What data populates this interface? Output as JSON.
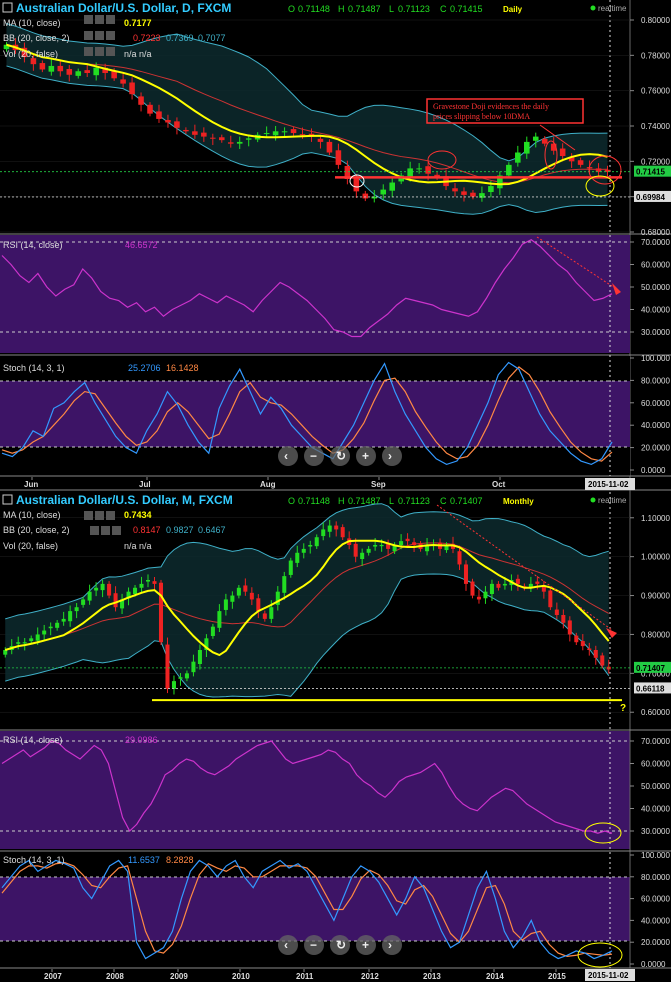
{
  "colors": {
    "up": "#22dd22",
    "down": "#ee2222",
    "ma": "#ffff00",
    "bb": "#3fb0c8",
    "bb_mid": "#cc3333",
    "rsi": "#cc33cc",
    "stoch_k": "#3399ff",
    "stoch_d": "#ff8844",
    "panel_purple": "#3d1466",
    "accent_cyan": "#33ccff",
    "hline": "#ff3333",
    "support": "#ffff00"
  },
  "daily": {
    "title": "Australian Dollar/U.S. Dollar, D, FXCM",
    "ohlc": {
      "o_label": "O",
      "o": "0.71148",
      "h_label": "H",
      "h": "0.71487",
      "l_label": "L",
      "l": "0.71123",
      "c_label": "C",
      "c": "0.71415"
    },
    "period_label": "Daily",
    "realtime": "realtime",
    "ma_label": "MA (10, close)",
    "ma_val": "0.7177",
    "bb_label": "BB (20, close, 2)",
    "bb_vals": [
      "0.7223",
      "0.7369",
      "0.7077"
    ],
    "vol_label": "Vol (20, false)",
    "vol_vals": "n/a  n/a",
    "annotation": [
      "Gravestone Doji evidences the daily",
      "prices slipping below 10DMA"
    ],
    "price_axis": [
      "0.80000",
      "0.78000",
      "0.76000",
      "0.74000",
      "0.72000",
      "0.70000",
      "0.68000"
    ],
    "price_tags": [
      "0.71415",
      "0.69984"
    ],
    "rsi_label": "RSI (14, close)",
    "rsi_val": "46.6572",
    "rsi_axis": [
      "70.0000",
      "60.0000",
      "50.0000",
      "40.0000",
      "30.0000"
    ],
    "stoch_label": "Stoch (14, 3, 1)",
    "stoch_k": "25.2706",
    "stoch_d": "16.1428",
    "stoch_axis": [
      "100.000",
      "80.0000",
      "60.0000",
      "40.0000",
      "20.0000",
      "0.0000"
    ],
    "months": [
      "Jun",
      "Jul",
      "Aug",
      "Sep",
      "Oct"
    ],
    "date_tag": "2015-11-02"
  },
  "monthly": {
    "title": "Australian Dollar/U.S. Dollar, M, FXCM",
    "ohlc": {
      "o_label": "O",
      "o": "0.71148",
      "h_label": "H",
      "h": "0.71487",
      "l_label": "L",
      "l": "0.71123",
      "c_label": "C",
      "c": "0.71407"
    },
    "period_label": "Monthly",
    "realtime": "realtime",
    "ma_label": "MA (10, close)",
    "ma_val": "0.7434",
    "bb_label": "BB (20, close, 2)",
    "bb_vals": [
      "0.8147",
      "0.9827",
      "0.6467"
    ],
    "vol_label": "Vol (20, false)",
    "vol_vals": "n/a  n/a",
    "price_axis": [
      "1.10000",
      "1.00000",
      "0.90000",
      "0.80000",
      "0.70000",
      "0.60000"
    ],
    "price_tags": [
      "0.71407",
      "0.66118"
    ],
    "question": "?",
    "rsi_label": "RSI (14, close)",
    "rsi_val": "29.0986",
    "rsi_axis": [
      "70.0000",
      "60.0000",
      "50.0000",
      "40.0000",
      "30.0000"
    ],
    "stoch_label": "Stoch (14, 3, 1)",
    "stoch_k": "11.6537",
    "stoch_d": "8.2828",
    "stoch_axis": [
      "100.000",
      "80.0000",
      "60.0000",
      "40.0000",
      "20.0000",
      "0.0000"
    ],
    "years": [
      "2007",
      "2008",
      "2009",
      "2010",
      "2011",
      "2012",
      "2013",
      "2014",
      "2015"
    ],
    "date_tag": "2015-11-02"
  },
  "nav_icons": [
    "chevron-left-icon",
    "minus-icon",
    "reset-icon",
    "plus-icon",
    "chevron-right-icon"
  ],
  "chart_data": [
    {
      "type": "candlestick",
      "title": "Australian Dollar/U.S. Dollar, D, FXCM",
      "ylim": [
        0.68,
        0.8
      ],
      "x_labels": [
        "Jun",
        "Jul",
        "Aug",
        "Sep",
        "Oct"
      ],
      "close_path": [
        0.786,
        0.783,
        0.779,
        0.775,
        0.772,
        0.774,
        0.771,
        0.769,
        0.771,
        0.77,
        0.773,
        0.77,
        0.767,
        0.764,
        0.758,
        0.752,
        0.747,
        0.744,
        0.742,
        0.739,
        0.737,
        0.735,
        0.734,
        0.733,
        0.732,
        0.73,
        0.731,
        0.733,
        0.735,
        0.736,
        0.737,
        0.737,
        0.736,
        0.735,
        0.734,
        0.731,
        0.725,
        0.718,
        0.71,
        0.703,
        0.699,
        0.7,
        0.704,
        0.708,
        0.712,
        0.716,
        0.716,
        0.713,
        0.711,
        0.706,
        0.703,
        0.701,
        0.7,
        0.702,
        0.706,
        0.712,
        0.718,
        0.725,
        0.731,
        0.734,
        0.73,
        0.726,
        0.723,
        0.72,
        0.718,
        0.716,
        0.714,
        0.714
      ],
      "ma10_last": 0.7177,
      "bb": {
        "mid": 0.7223,
        "upper": 0.7369,
        "lower": 0.7077
      },
      "last": {
        "open": 0.71148,
        "high": 0.71487,
        "low": 0.71123,
        "close": 0.71415
      },
      "support_line": 0.7109,
      "rsi": [
        64,
        60,
        55,
        52,
        56,
        50,
        46,
        49,
        51,
        58,
        54,
        48,
        45,
        44,
        41,
        43,
        39,
        41,
        37,
        40,
        42,
        44,
        47,
        45,
        43,
        46,
        44,
        42,
        39,
        44,
        48,
        52,
        50,
        47,
        44,
        40,
        36,
        31,
        30,
        28,
        28,
        32,
        35,
        38,
        42,
        45,
        44,
        43,
        42,
        40,
        39,
        38,
        37,
        39,
        45,
        52,
        58,
        63,
        69,
        71,
        68,
        64,
        60,
        57,
        52,
        48,
        44,
        45,
        47
      ],
      "stoch_k": [
        15,
        12,
        20,
        35,
        30,
        55,
        60,
        70,
        78,
        60,
        45,
        30,
        20,
        15,
        35,
        50,
        70,
        58,
        40,
        25,
        15,
        55,
        75,
        90,
        70,
        50,
        65,
        55,
        40,
        30,
        20,
        15,
        10,
        25,
        40,
        60,
        80,
        95,
        70,
        50,
        35,
        20,
        10,
        5,
        8,
        20,
        40,
        60,
        85,
        96,
        90,
        70,
        50,
        35,
        25,
        15,
        8,
        5,
        10,
        25
      ],
      "stoch_d": [
        18,
        15,
        18,
        25,
        30,
        40,
        50,
        62,
        70,
        68,
        55,
        42,
        30,
        22,
        25,
        35,
        52,
        60,
        52,
        40,
        28,
        32,
        50,
        70,
        78,
        65,
        60,
        58,
        50,
        40,
        30,
        22,
        15,
        18,
        28,
        42,
        62,
        80,
        82,
        70,
        52,
        38,
        25,
        15,
        10,
        12,
        22,
        40,
        62,
        82,
        92,
        85,
        70,
        52,
        38,
        25,
        16,
        10,
        8,
        16
      ]
    },
    {
      "type": "candlestick",
      "title": "Australian Dollar/U.S. Dollar, M, FXCM",
      "ylim": [
        0.58,
        1.12
      ],
      "x_labels": [
        "2007",
        "2008",
        "2009",
        "2010",
        "2011",
        "2012",
        "2013",
        "2014",
        "2015"
      ],
      "close_path": [
        0.76,
        0.77,
        0.78,
        0.78,
        0.79,
        0.8,
        0.81,
        0.82,
        0.83,
        0.84,
        0.86,
        0.87,
        0.89,
        0.91,
        0.92,
        0.93,
        0.9,
        0.87,
        0.89,
        0.91,
        0.92,
        0.93,
        0.94,
        0.93,
        0.78,
        0.66,
        0.68,
        0.69,
        0.7,
        0.73,
        0.76,
        0.79,
        0.82,
        0.86,
        0.89,
        0.9,
        0.92,
        0.91,
        0.89,
        0.86,
        0.84,
        0.87,
        0.91,
        0.95,
        0.99,
        1.01,
        1.02,
        1.03,
        1.05,
        1.07,
        1.08,
        1.07,
        1.05,
        1.03,
        1.0,
        1.01,
        1.02,
        1.03,
        1.03,
        1.02,
        1.03,
        1.04,
        1.04,
        1.03,
        1.02,
        1.03,
        1.03,
        1.02,
        1.03,
        1.02,
        0.98,
        0.93,
        0.9,
        0.89,
        0.91,
        0.93,
        0.92,
        0.93,
        0.94,
        0.93,
        0.92,
        0.93,
        0.93,
        0.91,
        0.87,
        0.85,
        0.83,
        0.8,
        0.78,
        0.77,
        0.76,
        0.74,
        0.72,
        0.71
      ],
      "ma10_last": 0.7434,
      "bb": {
        "mid": 0.8147,
        "upper": 0.9827,
        "lower": 0.6467
      },
      "last": {
        "open": 0.71148,
        "high": 0.71487,
        "low": 0.71123,
        "close": 0.71407
      },
      "support_line": 0.6312,
      "rsi": [
        60,
        62,
        64,
        66,
        63,
        65,
        67,
        70,
        69,
        66,
        64,
        62,
        65,
        68,
        66,
        60,
        48,
        36,
        30,
        33,
        38,
        42,
        48,
        55,
        57,
        60,
        62,
        61,
        58,
        56,
        55,
        57,
        59,
        62,
        64,
        66,
        68,
        69,
        70,
        66,
        62,
        60,
        61,
        62,
        63,
        64,
        66,
        65,
        62,
        60,
        55,
        52,
        50,
        47,
        45,
        48,
        52,
        54,
        55,
        56,
        58,
        60,
        56,
        50,
        45,
        42,
        40,
        39,
        42,
        45,
        47,
        49,
        48,
        45,
        42,
        40,
        38,
        36,
        34,
        33,
        32,
        31,
        30,
        30,
        29,
        30,
        29
      ],
      "stoch_k": [
        70,
        80,
        90,
        95,
        85,
        90,
        95,
        92,
        88,
        70,
        60,
        75,
        90,
        95,
        85,
        20,
        5,
        10,
        15,
        30,
        60,
        85,
        95,
        90,
        80,
        90,
        95,
        80,
        70,
        85,
        90,
        95,
        88,
        92,
        85,
        70,
        55,
        40,
        60,
        80,
        90,
        85,
        75,
        60,
        45,
        60,
        80,
        70,
        50,
        30,
        15,
        20,
        45,
        70,
        85,
        60,
        30,
        15,
        25,
        40,
        20,
        10,
        5,
        8,
        12,
        10,
        5,
        8,
        12
      ],
      "stoch_d": [
        65,
        75,
        85,
        90,
        90,
        88,
        92,
        93,
        90,
        82,
        72,
        70,
        80,
        88,
        90,
        60,
        30,
        12,
        10,
        18,
        35,
        60,
        82,
        92,
        88,
        85,
        90,
        88,
        80,
        80,
        85,
        90,
        90,
        90,
        88,
        80,
        65,
        50,
        50,
        62,
        78,
        86,
        82,
        72,
        58,
        55,
        68,
        72,
        62,
        45,
        28,
        20,
        30,
        50,
        70,
        72,
        55,
        30,
        22,
        28,
        30,
        18,
        10,
        7,
        8,
        10,
        9,
        8,
        9
      ]
    }
  ]
}
